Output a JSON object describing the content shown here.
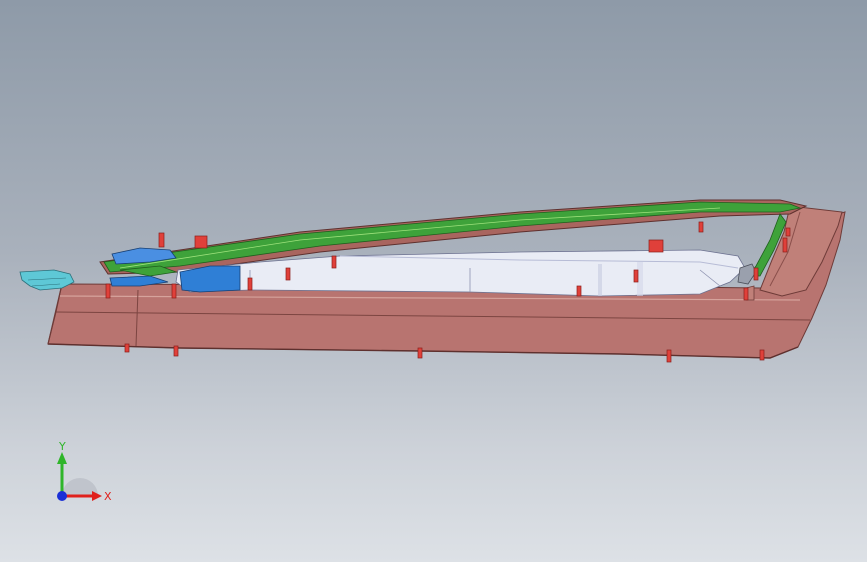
{
  "viewport": {
    "background": [
      "#8e9aa8",
      "#dde1e6"
    ]
  },
  "model": {
    "colors": {
      "housing": "#b4706a",
      "housing_dark": "#8a4f4b",
      "housing_light": "#d19a93",
      "green_rail": "#3ea23a",
      "inner_white": "#e9ecf5",
      "inner_shade": "#c7cbe0",
      "blue_part": "#2f7fd6",
      "cyan_part": "#5ec8d6",
      "pin_red": "#e0403a"
    }
  },
  "triad": {
    "x_label": "X",
    "y_label": "Y",
    "x_color": "#e0201c",
    "y_color": "#2fb52a",
    "z_color": "#1a2fd6"
  }
}
